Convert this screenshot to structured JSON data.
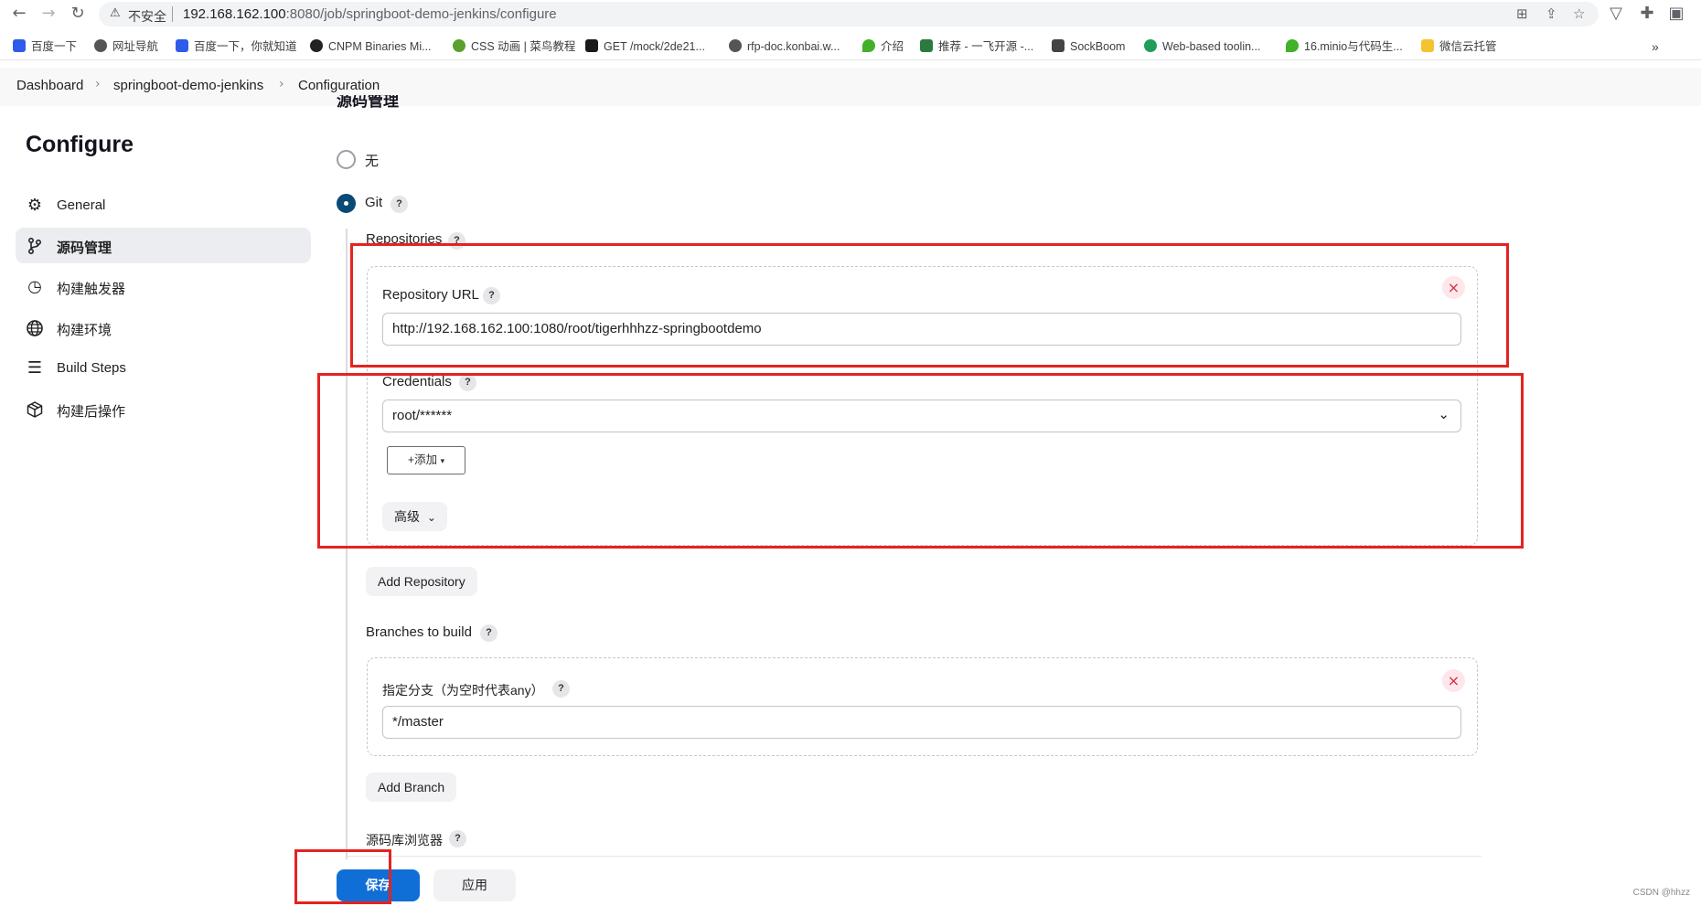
{
  "browser": {
    "insecure_label": "不安全",
    "url_host": "192.168.162.100",
    "url_rest": ":8080/job/springboot-demo-jenkins/configure",
    "bookmarks": [
      {
        "label": "百度一下",
        "color": "#2f5bea"
      },
      {
        "label": "网址导航",
        "color": "#555555"
      },
      {
        "label": "百度一下，你就知道",
        "color": "#2f5bea"
      },
      {
        "label": "CNPM Binaries Mi...",
        "color": "#222222"
      },
      {
        "label": "CSS 动画 | 菜鸟教程",
        "color": "#5aa02c"
      },
      {
        "label": "GET /mock/2de21...",
        "color": "#1a1a1a"
      },
      {
        "label": "rfp-doc.konbai.w...",
        "color": "#555555"
      },
      {
        "label": "介绍",
        "color": "#43b02a"
      },
      {
        "label": "推荐 - 一飞开源 -...",
        "color": "#2c7a3f"
      },
      {
        "label": "SockBoom",
        "color": "#444444"
      },
      {
        "label": "Web-based toolin...",
        "color": "#1e9e58"
      },
      {
        "label": "16.minio与代码生...",
        "color": "#43b02a"
      },
      {
        "label": "微信云托管",
        "color": "#f4c430"
      }
    ],
    "more": "»"
  },
  "breadcrumb": [
    "Dashboard",
    "springboot-demo-jenkins",
    "Configuration"
  ],
  "sidebar": {
    "title": "Configure",
    "items": [
      {
        "label": "General",
        "icon": "gear-icon"
      },
      {
        "label": "源码管理",
        "icon": "branch-icon"
      },
      {
        "label": "构建触发器",
        "icon": "clock-icon"
      },
      {
        "label": "构建环境",
        "icon": "globe-icon"
      },
      {
        "label": "Build Steps",
        "icon": "list-icon"
      },
      {
        "label": "构建后操作",
        "icon": "package-icon"
      }
    ]
  },
  "scm": {
    "section_title": "源码管理",
    "option_none": "无",
    "option_git": "Git",
    "repositories_label": "Repositories",
    "repo_url_label": "Repository URL",
    "repo_url_value": "http://192.168.162.100:1080/root/tigerhhhzz-springbootdemo",
    "credentials_label": "Credentials",
    "credentials_value": "root/******",
    "add_button": "+添加",
    "advanced_button": "高级",
    "add_repository": "Add Repository",
    "branches_label": "Branches to build",
    "branch_spec_label": "指定分支（为空时代表any）",
    "branch_spec_value": "*/master",
    "add_branch": "Add Branch",
    "repo_browser_label": "源码库浏览器",
    "help": "?"
  },
  "actions": {
    "save": "保存",
    "apply": "应用"
  },
  "watermark": "CSDN @hhzz",
  "colors": {
    "primary": "#0f6fd6",
    "highlight": "#e42320",
    "selected_radio": "#0b4a75"
  }
}
